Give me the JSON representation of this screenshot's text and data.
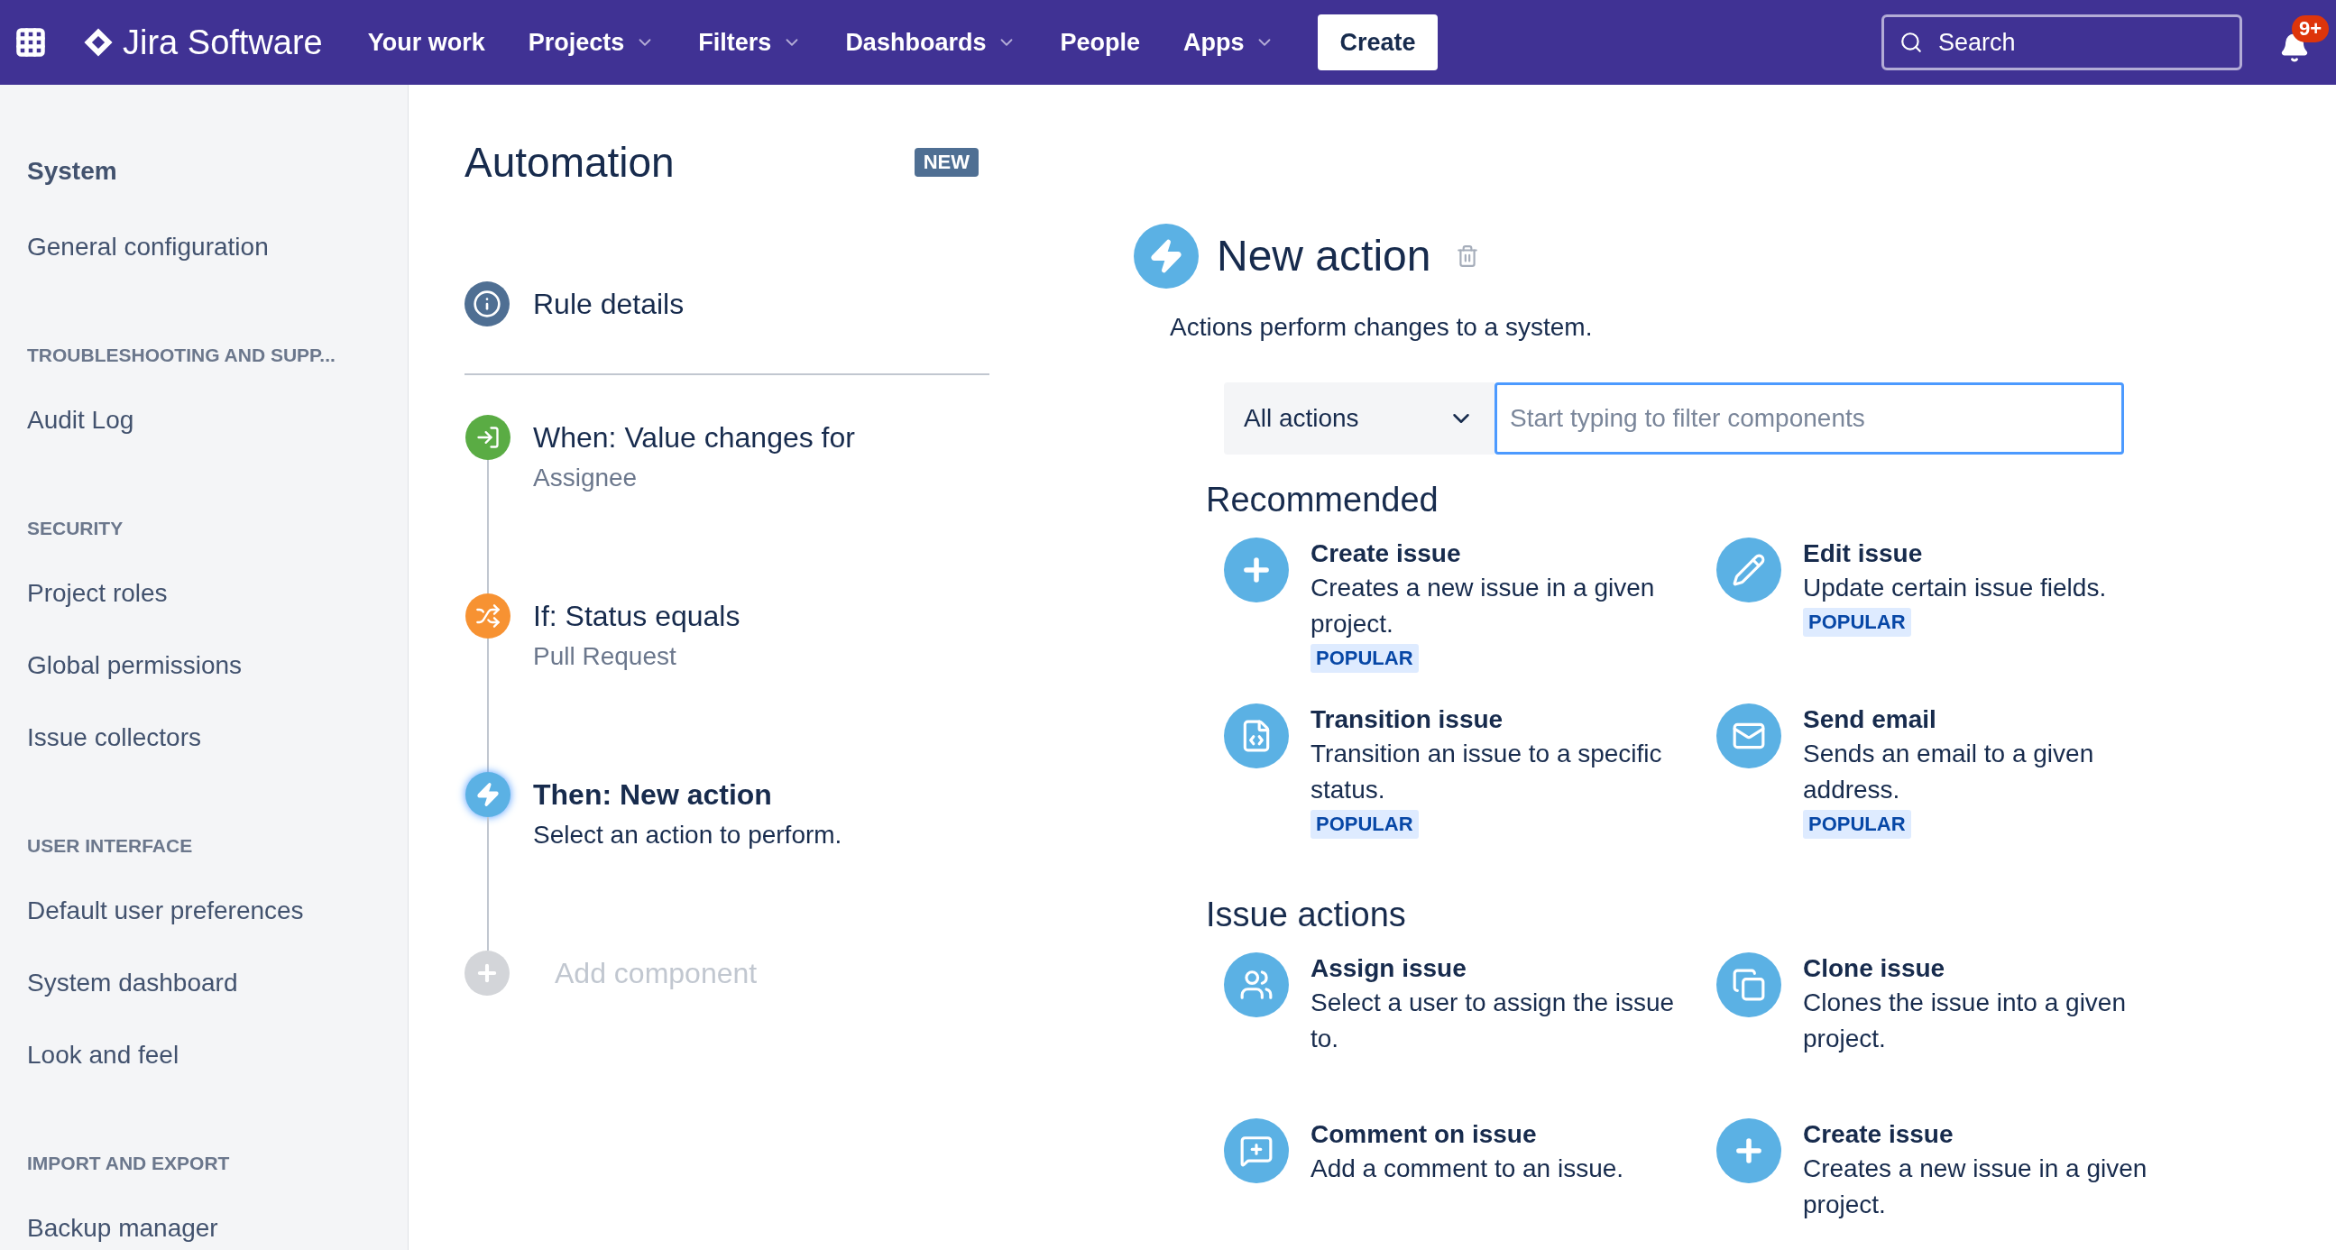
{
  "topbar": {
    "product": "Jira Software",
    "nav": [
      {
        "label": "Your work",
        "dropdown": false
      },
      {
        "label": "Projects",
        "dropdown": true
      },
      {
        "label": "Filters",
        "dropdown": true
      },
      {
        "label": "Dashboards",
        "dropdown": true
      },
      {
        "label": "People",
        "dropdown": false
      },
      {
        "label": "Apps",
        "dropdown": true
      }
    ],
    "create": "Create",
    "search": {
      "placeholder": "Search"
    },
    "notifications": "9+"
  },
  "sidebar": {
    "title": "System",
    "sections": [
      {
        "items": [
          "General configuration"
        ]
      },
      {
        "heading": "TROUBLESHOOTING AND SUPP...",
        "items": [
          "Audit Log"
        ]
      },
      {
        "heading": "SECURITY",
        "items": [
          "Project roles",
          "Global permissions",
          "Issue collectors"
        ]
      },
      {
        "heading": "USER INTERFACE",
        "items": [
          "Default user preferences",
          "System dashboard",
          "Look and feel"
        ]
      },
      {
        "heading": "IMPORT AND EXPORT",
        "items": [
          "Backup manager"
        ]
      }
    ]
  },
  "rule": {
    "title": "Automation",
    "badge": "NEW",
    "details": "Rule details",
    "steps": [
      {
        "kind": "trigger",
        "title": "When: Value changes for",
        "subtitle": "Assignee",
        "color": "#5aac44",
        "selected": false
      },
      {
        "kind": "condition",
        "title": "If: Status equals",
        "subtitle": "Pull Request",
        "color": "#f79232",
        "selected": false
      },
      {
        "kind": "action",
        "title": "Then: New action",
        "subtitle": "Select an action to perform.",
        "color": "#5bb1e4",
        "selected": true
      }
    ],
    "add": "Add component"
  },
  "panel": {
    "title": "New action",
    "subtitle": "Actions perform changes to a system.",
    "filter_select": "All actions",
    "filter": {
      "placeholder": "Start typing to filter components"
    },
    "groups": [
      {
        "heading": "Recommended",
        "items": [
          {
            "kind": "create",
            "title": "Create issue",
            "description": "Creates a new issue in a given project.",
            "badge": "POPULAR"
          },
          {
            "kind": "edit",
            "title": "Edit issue",
            "description": "Update certain issue fields.",
            "badge": "POPULAR"
          },
          {
            "kind": "transition",
            "title": "Transition issue",
            "description": "Transition an issue to a specific status.",
            "badge": "POPULAR"
          },
          {
            "kind": "email",
            "title": "Send email",
            "description": "Sends an email to a given address.",
            "badge": "POPULAR"
          }
        ]
      },
      {
        "heading": "Issue actions",
        "items": [
          {
            "kind": "assign",
            "title": "Assign issue",
            "description": "Select a user to assign the issue to."
          },
          {
            "kind": "clone",
            "title": "Clone issue",
            "description": "Clones the issue into a given project."
          },
          {
            "kind": "comment",
            "title": "Comment on issue",
            "description": "Add a comment to an issue."
          },
          {
            "kind": "create",
            "title": "Create issue",
            "description": "Creates a new issue in a given project."
          }
        ]
      }
    ]
  }
}
